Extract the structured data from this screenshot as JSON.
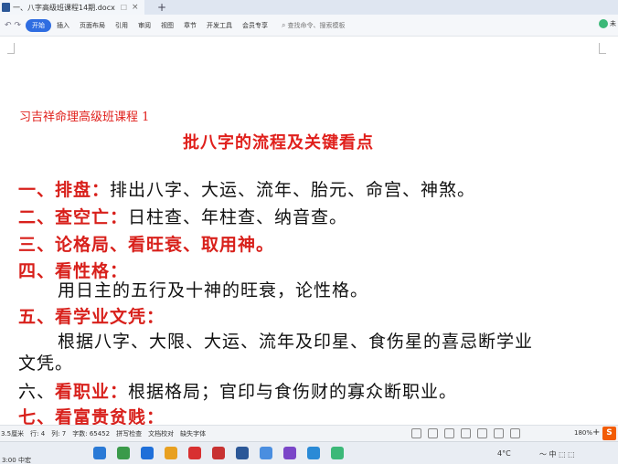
{
  "window": {
    "tab_title": "一、八字高级班课程14期.docx",
    "tab_pin": "☐",
    "tab_close": "×",
    "new_tab": "+"
  },
  "ribbon": {
    "undo_glyphs": "↶ ↷",
    "start_label": "开始",
    "menu": [
      "插入",
      "页面布局",
      "引用",
      "审阅",
      "视图",
      "章节",
      "开发工具",
      "会员专享"
    ],
    "search_placeholder": "查找命令、搜索模板",
    "right_label": "未"
  },
  "document": {
    "header": "习吉祥命理高级班课程 1",
    "title": "批八字的流程及关键看点",
    "lines": [
      {
        "red": "一、排盘：",
        "black": "排出八字、大运、流年、胎元、命宫、神煞。"
      },
      {
        "red": "二、查空亡：",
        "black": "日柱查、年柱查、纳音查。"
      },
      {
        "red": "三、论格局、看旺衰、取用神。",
        "black": ""
      },
      {
        "red": "四、看性格：",
        "black": ""
      },
      {
        "red": "",
        "black": "用日主的五行及十神的旺衰，论性格。"
      },
      {
        "red": "五、看学业文凭：",
        "black": ""
      },
      {
        "red": "",
        "black": "根据八字、大限、大运、流年及印星、食伤星的喜忌断学业"
      },
      {
        "red": "",
        "black": "文凭。"
      },
      {
        "black_prefix": "六、",
        "red": "看职业：",
        "black": "根据格局；官印与食伤财的寡众断职业。"
      },
      {
        "red": "七、看富贵贫贱：",
        "black": ""
      }
    ]
  },
  "statusbar": {
    "position": "3.5厘米",
    "row": "行: 4",
    "col": "列: 7",
    "word_count": "字数: 65452",
    "spellcheck": "拼写检查",
    "proofread": "文档校对",
    "missing_font": "缺失字体",
    "zoom": "180%",
    "zoom_plus": "+",
    "sogou": "S"
  },
  "taskbar": {
    "left_text": "3:00 中宏",
    "temperature": "4°C",
    "tray": "〜 中 ⬚ ⬚",
    "app_colors": [
      "#2a7ad6",
      "#3a9a4a",
      "#1e6fd9",
      "#e8a020",
      "#d83030",
      "#c83232",
      "#2b5797",
      "#4a8ee0",
      "#7a46c8",
      "#2a8ad6",
      "#3cb878"
    ]
  },
  "colors": {
    "heading_red": "#d8201b",
    "accent_blue": "#2f6de1"
  }
}
